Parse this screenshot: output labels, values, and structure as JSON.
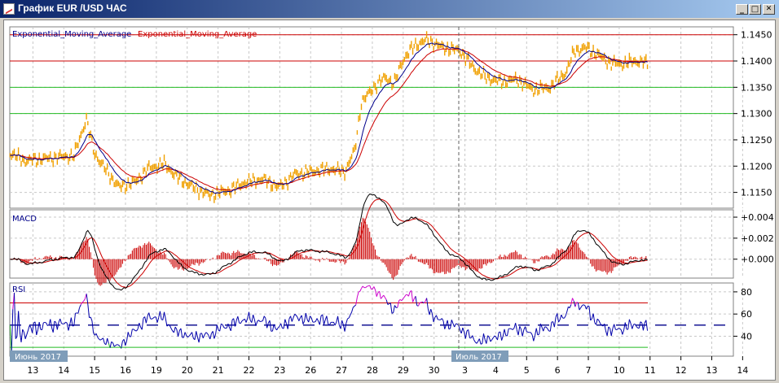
{
  "window": {
    "title": "График EUR /USD  ЧАС",
    "minimize": "_",
    "maximize": "□",
    "close": "✕"
  },
  "legend": {
    "ema_fast": "Exponential_Moving_Average",
    "ema_slow": "Exponential_Moving_Average"
  },
  "panels": {
    "macd": "MACD",
    "rsi": "RSI"
  },
  "month_labels": [
    "Июнь 2017",
    "Июль 2017"
  ],
  "colors": {
    "price": "#f0a000",
    "ema_fast": "#00008b",
    "ema_slow": "#cc0000",
    "macd_hist": "#cc0000",
    "rsi": "#0000aa",
    "rsi_over": "#cc00cc",
    "rsi_under": "#22bb22",
    "level_red": "#cc0000",
    "level_green": "#22bb22"
  },
  "chart_data": [
    {
      "type": "line",
      "name": "price",
      "title": "EUR/USD H1",
      "ylim": [
        1.112,
        1.1465
      ],
      "y_ticks": [
        "1.1450",
        "1.1400",
        "1.1350",
        "1.1300",
        "1.1250",
        "1.1200",
        "1.1150"
      ],
      "y_tick_values": [
        1.145,
        1.14,
        1.135,
        1.13,
        1.125,
        1.12,
        1.115
      ],
      "levels": {
        "red": [
          1.145,
          1.14
        ],
        "green": [
          1.135,
          1.13
        ]
      },
      "x_ticks": [
        "13",
        "14",
        "15",
        "16",
        "19",
        "20",
        "21",
        "22",
        "23",
        "26",
        "27",
        "28",
        "29",
        "30",
        "3",
        "4",
        "5",
        "6",
        "7",
        "10",
        "11",
        "12",
        "13",
        "14"
      ],
      "xlim": [
        -0.75,
        22.7
      ],
      "points": [
        [
          -0.74,
          1.1225
        ],
        [
          -0.27,
          1.121
        ],
        [
          0.53,
          1.1215
        ],
        [
          1.33,
          1.122
        ],
        [
          1.73,
          1.129
        ],
        [
          1.99,
          1.1225
        ],
        [
          2.39,
          1.119
        ],
        [
          2.79,
          1.116
        ],
        [
          3.32,
          1.117
        ],
        [
          3.72,
          1.1195
        ],
        [
          4.26,
          1.1205
        ],
        [
          4.65,
          1.118
        ],
        [
          5.19,
          1.116
        ],
        [
          5.72,
          1.1145
        ],
        [
          6.38,
          1.1155
        ],
        [
          6.91,
          1.117
        ],
        [
          7.45,
          1.1175
        ],
        [
          7.98,
          1.116
        ],
        [
          8.51,
          1.1185
        ],
        [
          9.04,
          1.119
        ],
        [
          9.57,
          1.1195
        ],
        [
          10.11,
          1.119
        ],
        [
          10.43,
          1.123
        ],
        [
          10.64,
          1.132
        ],
        [
          11.04,
          1.135
        ],
        [
          11.44,
          1.137
        ],
        [
          11.7,
          1.1355
        ],
        [
          11.97,
          1.14
        ],
        [
          12.37,
          1.143
        ],
        [
          12.77,
          1.144
        ],
        [
          13.3,
          1.1425
        ],
        [
          13.83,
          1.142
        ],
        [
          14.23,
          1.139
        ],
        [
          14.63,
          1.137
        ],
        [
          15.16,
          1.136
        ],
        [
          15.69,
          1.1365
        ],
        [
          16.22,
          1.1345
        ],
        [
          16.76,
          1.135
        ],
        [
          17.29,
          1.138
        ],
        [
          17.55,
          1.142
        ],
        [
          17.95,
          1.1425
        ],
        [
          18.35,
          1.141
        ],
        [
          18.75,
          1.1395
        ],
        [
          19.15,
          1.1395
        ],
        [
          19.55,
          1.14
        ],
        [
          19.95,
          1.1395
        ]
      ]
    },
    {
      "type": "bar",
      "name": "macd",
      "ylim": [
        -0.0018,
        0.0047
      ],
      "y_ticks": [
        "+0.004",
        "+0.002",
        "+0.000"
      ],
      "y_tick_values": [
        0.004,
        0.002,
        0
      ]
    },
    {
      "type": "line",
      "name": "rsi",
      "ylim": [
        22,
        88
      ],
      "y_ticks": [
        "80",
        "60",
        "40"
      ],
      "y_tick_values": [
        80,
        60,
        40
      ],
      "levels": {
        "over": 70,
        "mid": 50,
        "under": 30
      }
    }
  ]
}
